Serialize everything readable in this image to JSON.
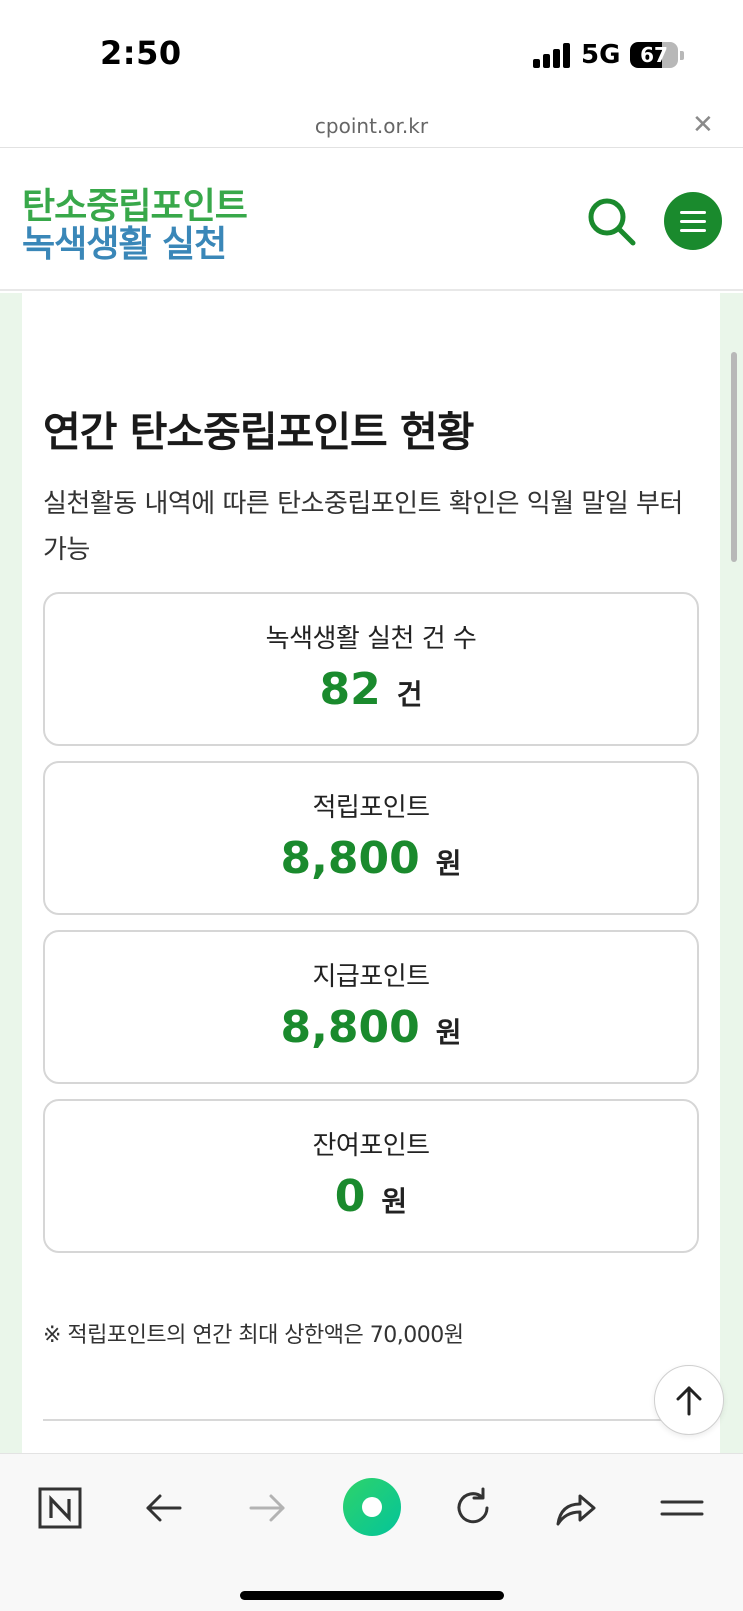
{
  "status_bar": {
    "time": "2:50",
    "network": "5G",
    "battery": "67",
    "battery_level_percent": 67
  },
  "browser": {
    "url": "cpoint.or.kr",
    "close_icon": "close-icon"
  },
  "header": {
    "logo_line1": "탄소중립포인트",
    "logo_line2": "녹색생활 실천",
    "search_icon": "search-icon",
    "menu_icon": "hamburger-menu-icon",
    "brand_green": "#38a84a",
    "brand_blue": "#3a87b8",
    "accent": "#1a8a2d"
  },
  "main": {
    "title": "연간 탄소중립포인트 현황",
    "description": "실천활동 내역에 따른 탄소중립포인트 확인은 익월 말일 부터 가능",
    "stats": [
      {
        "label": "녹색생활 실천 건 수",
        "value": "82",
        "unit": "건"
      },
      {
        "label": "적립포인트",
        "value": "8,800",
        "unit": "원"
      },
      {
        "label": "지급포인트",
        "value": "8,800",
        "unit": "원"
      },
      {
        "label": "잔여포인트",
        "value": "0",
        "unit": "원"
      }
    ],
    "note": "※ 적립포인트의 연간 최대 상한액은 70,000원",
    "scroll_top_icon": "arrow-up-icon"
  },
  "toolbar": {
    "icons": [
      "naver-n-icon",
      "back-arrow-icon",
      "forward-arrow-icon",
      "green-dot-icon",
      "reload-icon",
      "share-icon",
      "menu-icon"
    ]
  }
}
